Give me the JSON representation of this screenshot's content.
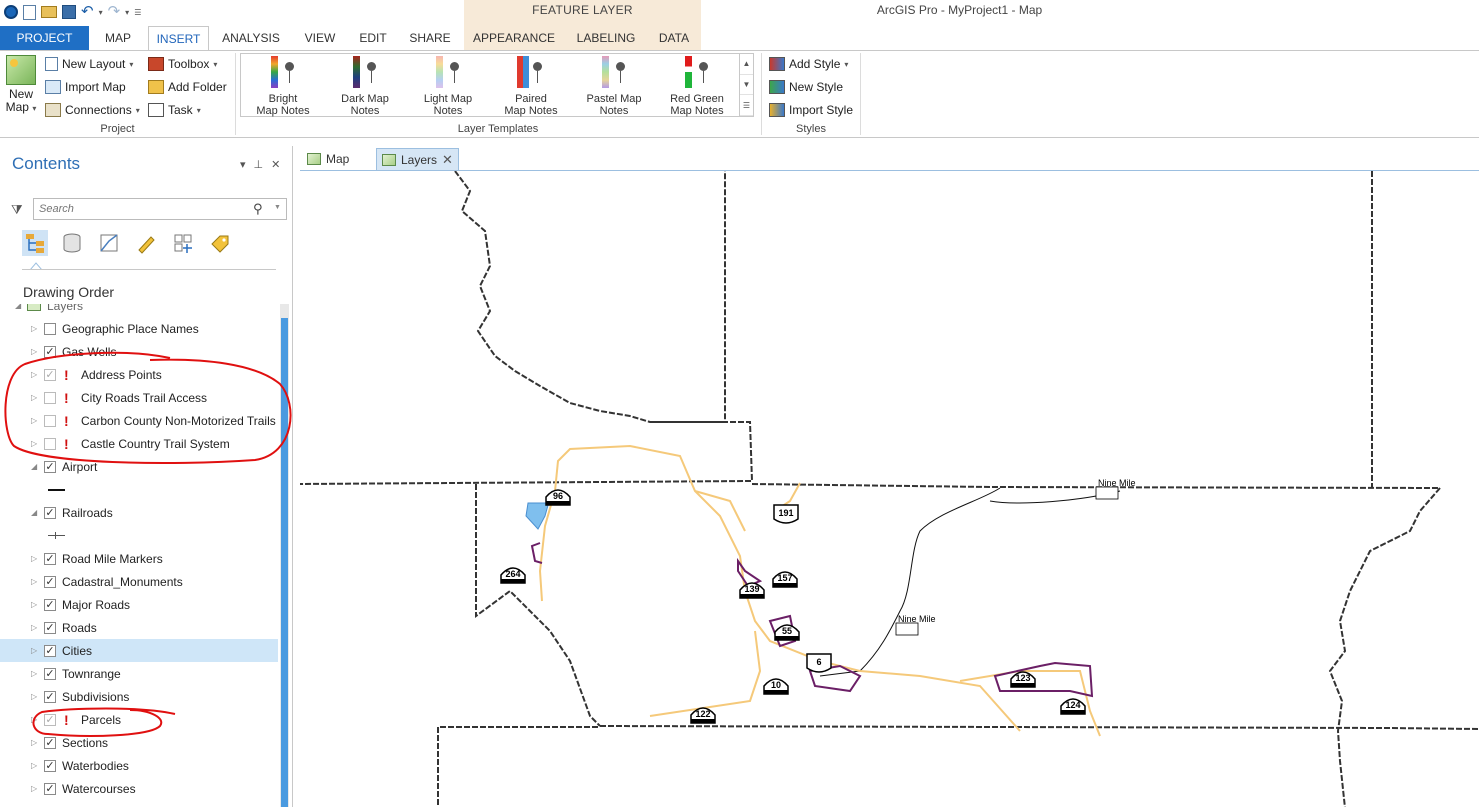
{
  "title_bar": {
    "app_title": "ArcGIS Pro - MyProject1 - Map",
    "contextual_tab_group": "FEATURE LAYER"
  },
  "ribbon_tabs": [
    "PROJECT",
    "MAP",
    "INSERT",
    "ANALYSIS",
    "VIEW",
    "EDIT",
    "SHARE",
    "APPEARANCE",
    "LABELING",
    "DATA"
  ],
  "active_tab": "INSERT",
  "ribbon": {
    "project_group": {
      "label": "Project",
      "new_map": "New Map",
      "new_map_l1": "New",
      "new_map_l2": "Map",
      "new_layout": "New Layout",
      "import_map": "Import Map",
      "connections": "Connections",
      "toolbox": "Toolbox",
      "add_folder": "Add Folder",
      "task": "Task"
    },
    "layer_templates_group": {
      "label": "Layer Templates",
      "templates": [
        {
          "l1": "Bright",
          "l2": "Map Notes"
        },
        {
          "l1": "Dark Map",
          "l2": "Notes"
        },
        {
          "l1": "Light Map",
          "l2": "Notes"
        },
        {
          "l1": "Paired",
          "l2": "Map Notes"
        },
        {
          "l1": "Pastel Map",
          "l2": "Notes"
        },
        {
          "l1": "Red Green",
          "l2": "Map Notes"
        }
      ]
    },
    "styles_group": {
      "label": "Styles",
      "add_style": "Add Style",
      "new_style": "New Style",
      "import_style": "Import Style"
    }
  },
  "contents": {
    "title": "Contents",
    "search_placeholder": "Search",
    "heading": "Drawing Order",
    "root_layer": "Layers",
    "layers": [
      {
        "name": "Geographic Place Names",
        "checked": false,
        "warning": false
      },
      {
        "name": "Gas Wells",
        "checked": true,
        "warning": false
      },
      {
        "name": "Address Points",
        "checked": true,
        "warning": true
      },
      {
        "name": "City Roads Trail Access",
        "checked": false,
        "warning": true
      },
      {
        "name": "Carbon County Non-Motorized Trails",
        "checked": false,
        "warning": true
      },
      {
        "name": "Castle Country Trail System",
        "checked": false,
        "warning": true
      },
      {
        "name": "Airport",
        "checked": true,
        "warning": false
      },
      {
        "name": "Railroads",
        "checked": true,
        "warning": false
      },
      {
        "name": "Road Mile Markers",
        "checked": true,
        "warning": false
      },
      {
        "name": "Cadastral_Monuments",
        "checked": true,
        "warning": false
      },
      {
        "name": "Major Roads",
        "checked": true,
        "warning": false
      },
      {
        "name": "Roads",
        "checked": true,
        "warning": false
      },
      {
        "name": "Cities",
        "checked": true,
        "warning": false,
        "selected": true
      },
      {
        "name": "Townrange",
        "checked": true,
        "warning": false
      },
      {
        "name": "Subdivisions",
        "checked": true,
        "warning": false
      },
      {
        "name": "Parcels",
        "checked": true,
        "warning": true
      },
      {
        "name": "Sections",
        "checked": true,
        "warning": false
      },
      {
        "name": "Waterbodies",
        "checked": true,
        "warning": false
      },
      {
        "name": "Watercourses",
        "checked": true,
        "warning": false
      }
    ]
  },
  "map_tabs": [
    {
      "label": "Map",
      "active": false
    },
    {
      "label": "Layers",
      "active": true
    }
  ],
  "map": {
    "shields": [
      "96",
      "191",
      "264",
      "157",
      "139",
      "55",
      "6",
      "10",
      "122",
      "123",
      "124"
    ],
    "place_labels": [
      "Nine Mile",
      "Nine Mile"
    ]
  },
  "colors": {
    "project_tab": "#1f6fc5",
    "active_tab_text": "#2266bb",
    "annotation_red": "#e01010",
    "trails": "#f5c97a",
    "parcels": "#6b1f66",
    "water": "#7fbfee"
  }
}
